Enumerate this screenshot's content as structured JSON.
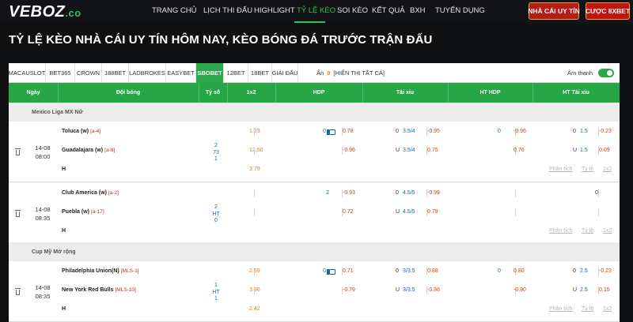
{
  "logo": {
    "main": "VEBOZ",
    "suffix": ".co"
  },
  "nav": {
    "items": [
      "TRANG CHỦ",
      "LỊCH THI ĐẤU",
      "HIGHLIGHT",
      "TỶ LỆ KÈO",
      "SOI KÈO",
      "KẾT QUẢ",
      "BXH",
      "TUYỂN DỤNG"
    ],
    "active_index": 3,
    "buttons": [
      "NHÀ CÁI UY TÍN",
      "CƯỢC 8XBET"
    ]
  },
  "page_title": "TỶ LỆ KÈO NHÀ CÁI UY TÍN HÔM NAY, KÈO BÓNG ĐÁ TRƯỚC TRẬN ĐẤU",
  "bookmakers": [
    "MACAUSLOT",
    "BET365",
    "CROWN",
    "188BET",
    "LADBROKES",
    "EASYBET",
    "SBOBET",
    "12BET",
    "18BET",
    "GIẢI ĐẤU"
  ],
  "active_bookmaker_index": 6,
  "hidden": {
    "label": "Ẩn",
    "count": "0",
    "show_all": "[HIỂN THỊ TẤT CẢ]"
  },
  "sound_label": "Âm thanh",
  "sound_on": true,
  "columns": [
    "Ngày",
    "Đội bóng",
    "Tỷ số",
    "1x2",
    "HDP",
    "Tài xỉu",
    "HT HDP",
    "HT Tài xỉu"
  ],
  "accent_color": "#27a645",
  "leagues": [
    {
      "name": "Mexico Liga MX Nữ",
      "matches": [
        {
          "date": "14-08",
          "time": "08:00",
          "home": "Toluca (w)",
          "home_rank": "[a-4]",
          "away": "Guadalajara (w)",
          "away_rank": "[a-8]",
          "draw_label": "H",
          "score": [
            "2",
            "73",
            "1"
          ],
          "x12": [
            "1.23",
            "12.50",
            "3.79"
          ],
          "hdp_line": "0",
          "hdp_tv": true,
          "hdp_odds": [
            "0.78",
            "-0.96"
          ],
          "ou_tags": [
            "0",
            "U"
          ],
          "ou_lines": [
            "3.5/4",
            "3.5/4"
          ],
          "ou_odds": [
            "-0.95",
            "0.75"
          ],
          "hthdp_line": "0",
          "hthdp_odds": [
            "-0.96",
            "0.76"
          ],
          "htou_tags": [
            "0",
            "U"
          ],
          "htou_lines": [
            "1.5",
            "1.5"
          ],
          "htou_odds": [
            "-0.23",
            "0.09"
          ],
          "links": [
            "Phân tích",
            "Tỷ lệ",
            "1x2"
          ]
        },
        {
          "date": "14-08",
          "time": "08:35",
          "home": "Club America (w)",
          "home_rank": "[a-2]",
          "away": "Puebla (w)",
          "away_rank": "[a-17]",
          "draw_label": "H",
          "score": [
            "2",
            "HT",
            "0"
          ],
          "x12": [
            "",
            "",
            ""
          ],
          "hdp_line": "2",
          "hdp_tv": false,
          "hdp_odds": [
            "-0.93",
            "0.72"
          ],
          "ou_tags": [
            "0",
            "U"
          ],
          "ou_lines": [
            "4.5/5",
            "4.5/5"
          ],
          "ou_odds": [
            "-0.99",
            "0.79"
          ],
          "hthdp_line": "",
          "hthdp_odds": [
            "",
            ""
          ],
          "htou_tags": [
            "",
            ""
          ],
          "htou_lines": [
            "0",
            ""
          ],
          "htou_odds": [
            "",
            ""
          ],
          "links": [
            "Phân tích",
            "Tỷ lệ",
            "1x2"
          ]
        }
      ]
    },
    {
      "name": "Cup Mỹ Mở rộng",
      "matches": [
        {
          "date": "14-08",
          "time": "08:35",
          "home": "Philadelphia Union(N)",
          "home_rank": "[MLS-1]",
          "away": "New York Red Bulls",
          "away_rank": "[MLS-10]",
          "draw_label": "H",
          "score": [
            "1",
            "HT",
            "1"
          ],
          "x12": [
            "2.69",
            "3.36",
            "2.42"
          ],
          "hdp_line": "0",
          "hdp_tv": true,
          "hdp_odds": [
            "0.71",
            "-0.79"
          ],
          "ou_tags": [
            "0",
            "U"
          ],
          "ou_lines": [
            "3/3.5",
            "3/3.5"
          ],
          "ou_odds": [
            "0.88",
            "-0.98"
          ],
          "hthdp_line": "0",
          "hthdp_odds": [
            "0.80",
            "-0.90"
          ],
          "htou_tags": [
            "0",
            "U"
          ],
          "htou_lines": [
            "2.5",
            "2.5"
          ],
          "htou_odds": [
            "-0.23",
            "0.15"
          ],
          "links": [
            "Phân tích",
            "Tỷ lệ",
            "1x2"
          ]
        }
      ]
    }
  ]
}
